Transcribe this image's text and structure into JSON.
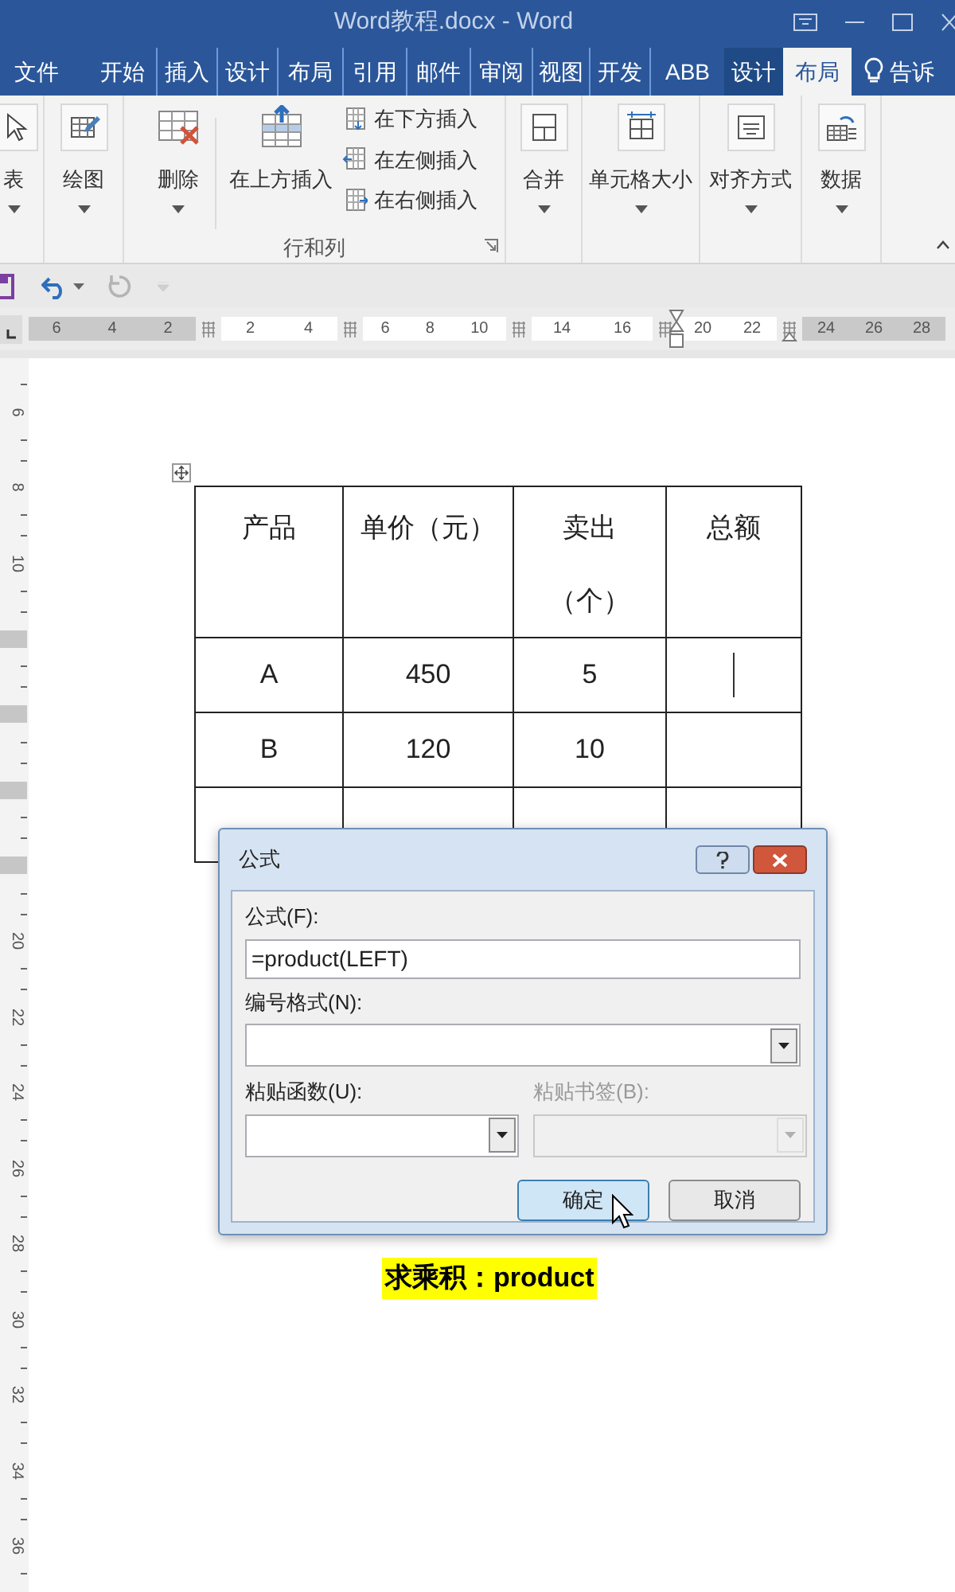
{
  "window": {
    "title": "Word教程.docx - Word"
  },
  "tabs": [
    {
      "label": "文件",
      "kind": "file",
      "selected": false
    },
    {
      "label": "开始",
      "kind": "normal",
      "selected": false
    },
    {
      "label": "插入",
      "kind": "normal",
      "selected": false
    },
    {
      "label": "设计",
      "kind": "normal",
      "selected": false
    },
    {
      "label": "布局",
      "kind": "normal",
      "selected": false
    },
    {
      "label": "引用",
      "kind": "normal",
      "selected": false
    },
    {
      "label": "邮件",
      "kind": "normal",
      "selected": false
    },
    {
      "label": "审阅",
      "kind": "normal",
      "selected": false
    },
    {
      "label": "视图",
      "kind": "normal",
      "selected": false
    },
    {
      "label": "开发",
      "kind": "normal",
      "selected": false
    },
    {
      "label": "ABB",
      "kind": "normal",
      "selected": false
    },
    {
      "label": "设计",
      "kind": "contextual",
      "selected": false
    },
    {
      "label": "布局",
      "kind": "contextual",
      "selected": true
    }
  ],
  "tell_me": {
    "text": "告诉"
  },
  "ribbon": {
    "groups": [
      {
        "buttons": [
          {
            "label": "表",
            "dropdown": true
          }
        ]
      },
      {
        "buttons": [
          {
            "label": "绘图",
            "dropdown": true
          }
        ]
      },
      {
        "label": "行和列",
        "buttons": [
          {
            "label": "删除",
            "dropdown": true
          },
          {
            "label": "在上方插入",
            "dropdown": false
          }
        ],
        "small_buttons": [
          "在下方插入",
          "在左侧插入",
          "在右侧插入"
        ]
      },
      {
        "buttons": [
          {
            "label": "合并",
            "dropdown": true
          }
        ]
      },
      {
        "buttons": [
          {
            "label": "单元格大小",
            "dropdown": true
          }
        ]
      },
      {
        "buttons": [
          {
            "label": "对齐方式",
            "dropdown": true
          }
        ]
      },
      {
        "buttons": [
          {
            "label": "数据",
            "dropdown": true
          }
        ]
      }
    ]
  },
  "ruler": {
    "segments": [
      {
        "kind": "margin",
        "labels": [
          "6",
          "4",
          "2"
        ]
      },
      {
        "kind": "cell",
        "labels": [
          "2",
          "4"
        ]
      },
      {
        "kind": "cell",
        "labels": [
          "6",
          "8",
          "10"
        ]
      },
      {
        "kind": "cell",
        "labels": [
          "14",
          "16"
        ]
      },
      {
        "kind": "cell",
        "labels": [
          "20",
          "22"
        ]
      },
      {
        "kind": "margin",
        "labels": [
          "24",
          "26",
          "28"
        ]
      }
    ]
  },
  "vertical_ruler": [
    {
      "kind": "number",
      "label": "6"
    },
    {
      "kind": "number",
      "label": "8"
    },
    {
      "kind": "number",
      "label": "10"
    },
    {
      "kind": "marker"
    },
    {
      "kind": "marker"
    },
    {
      "kind": "marker"
    },
    {
      "kind": "marker"
    },
    {
      "kind": "number",
      "label": "20"
    },
    {
      "kind": "number",
      "label": "22"
    },
    {
      "kind": "number",
      "label": "24"
    },
    {
      "kind": "number",
      "label": "26"
    },
    {
      "kind": "number",
      "label": "28"
    },
    {
      "kind": "number",
      "label": "30"
    },
    {
      "kind": "number",
      "label": "32"
    },
    {
      "kind": "number",
      "label": "34"
    },
    {
      "kind": "number",
      "label": "36"
    }
  ],
  "table": {
    "header": [
      {
        "lines": [
          "产品"
        ]
      },
      {
        "lines": [
          "单价（元）"
        ]
      },
      {
        "lines": [
          "卖出",
          "（个）"
        ]
      },
      {
        "lines": [
          "总额"
        ]
      }
    ],
    "rows": [
      [
        "A",
        "450",
        "5"
      ],
      [
        "B",
        "120",
        "10"
      ]
    ]
  },
  "dialog": {
    "title": "公式",
    "formula": {
      "label": "公式(F):",
      "value": "=product(LEFT)"
    },
    "number_format": {
      "label": "编号格式(N):"
    },
    "paste_function": {
      "label": "粘贴函数(U):",
      "disabled": false
    },
    "paste_bookmark": {
      "label": "粘贴书签(B):",
      "disabled": true
    },
    "buttons": [
      {
        "label": "确定",
        "focused": true
      },
      {
        "label": "取消",
        "focused": false
      }
    ]
  },
  "caption": {
    "text": "求乘积：product"
  }
}
